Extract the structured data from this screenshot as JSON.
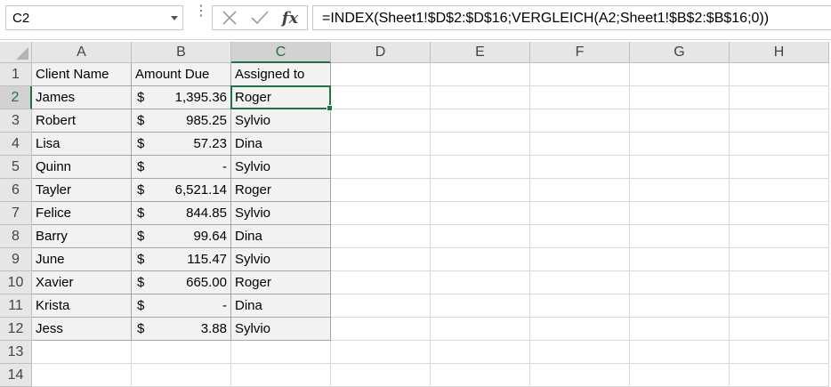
{
  "name_box": "C2",
  "formula": "=INDEX(Sheet1!$D$2:$D$16;VERGLEICH(A2;Sheet1!$B$2:$B$16;0))",
  "fx_label": "fx",
  "columns": [
    "A",
    "B",
    "C",
    "D",
    "E",
    "F",
    "G",
    "H"
  ],
  "selected_column": "C",
  "selected_row": 2,
  "rows": [
    "1",
    "2",
    "3",
    "4",
    "5",
    "6",
    "7",
    "8",
    "9",
    "10",
    "11",
    "12",
    "13",
    "14"
  ],
  "headers": {
    "a": "Client Name",
    "b": "Amount Due",
    "c": "Assigned to"
  },
  "data": [
    {
      "client": "James",
      "currency": "$",
      "amount": "1,395.36",
      "assigned": "Roger"
    },
    {
      "client": "Robert",
      "currency": "$",
      "amount": "985.25",
      "assigned": "Sylvio"
    },
    {
      "client": "Lisa",
      "currency": "$",
      "amount": "57.23",
      "assigned": "Dina"
    },
    {
      "client": "Quinn",
      "currency": "$",
      "amount": "-",
      "assigned": "Sylvio"
    },
    {
      "client": "Tayler",
      "currency": "$",
      "amount": "6,521.14",
      "assigned": "Roger"
    },
    {
      "client": "Felice",
      "currency": "$",
      "amount": "844.85",
      "assigned": "Sylvio"
    },
    {
      "client": "Barry",
      "currency": "$",
      "amount": "99.64",
      "assigned": "Dina"
    },
    {
      "client": "June",
      "currency": "$",
      "amount": "115.47",
      "assigned": "Sylvio"
    },
    {
      "client": "Xavier",
      "currency": "$",
      "amount": "665.00",
      "assigned": "Roger"
    },
    {
      "client": "Krista",
      "currency": "$",
      "amount": "-",
      "assigned": "Dina"
    },
    {
      "client": "Jess",
      "currency": "$",
      "amount": "3.88",
      "assigned": "Sylvio"
    }
  ],
  "colors": {
    "accent": "#217346",
    "fill": "#f2f2f2",
    "header_bg": "#e6e6e6"
  }
}
